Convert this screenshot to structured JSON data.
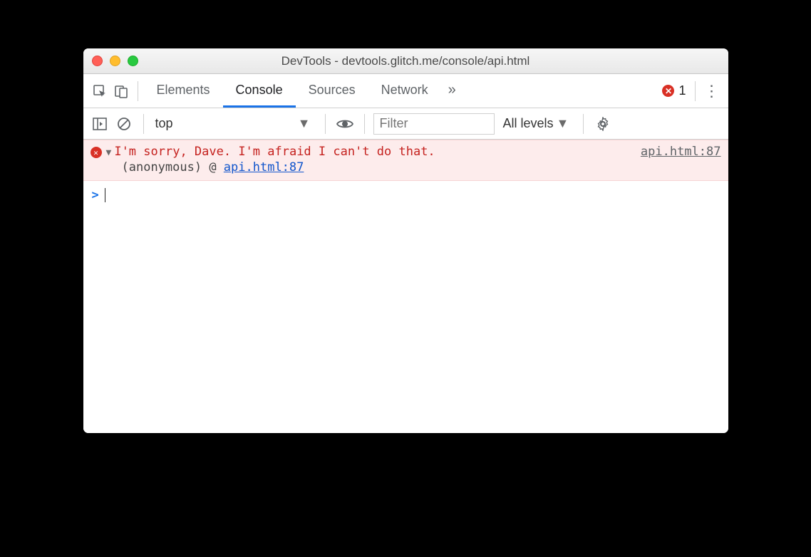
{
  "window": {
    "title": "DevTools - devtools.glitch.me/console/api.html"
  },
  "tabs": {
    "items": [
      "Elements",
      "Console",
      "Sources",
      "Network"
    ],
    "active": "Console",
    "overflow_glyph": "»",
    "error_count": "1"
  },
  "console_toolbar": {
    "context": "top",
    "filter_placeholder": "Filter",
    "levels_label": "All levels"
  },
  "console": {
    "error": {
      "message": "I'm sorry, Dave. I'm afraid I can't do that.",
      "source": "api.html:87",
      "stack_prefix": "(anonymous) @ ",
      "stack_link": "api.html:87"
    },
    "prompt": ">"
  }
}
